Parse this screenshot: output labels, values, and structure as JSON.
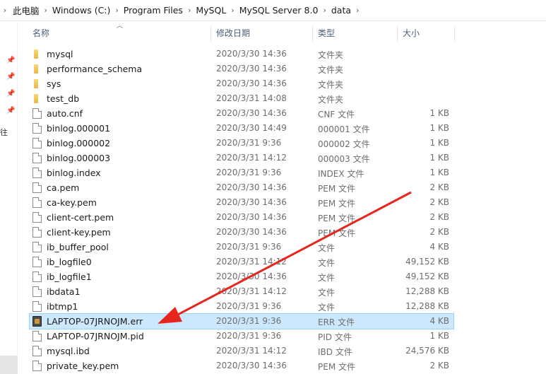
{
  "breadcrumb": [
    "此电脑",
    "Windows (C:)",
    "Program Files",
    "MySQL",
    "MySQL Server 8.0",
    "data"
  ],
  "left_rail_text": "往",
  "columns": {
    "name": "名称",
    "date": "修改日期",
    "type": "类型",
    "size": "大小"
  },
  "files": [
    {
      "name": "mysql",
      "date": "2020/3/30 14:36",
      "type": "文件夹",
      "size": "",
      "kind": "folder"
    },
    {
      "name": "performance_schema",
      "date": "2020/3/30 14:36",
      "type": "文件夹",
      "size": "",
      "kind": "folder"
    },
    {
      "name": "sys",
      "date": "2020/3/30 14:36",
      "type": "文件夹",
      "size": "",
      "kind": "folder"
    },
    {
      "name": "test_db",
      "date": "2020/3/31 14:08",
      "type": "文件夹",
      "size": "",
      "kind": "folder"
    },
    {
      "name": "auto.cnf",
      "date": "2020/3/30 14:36",
      "type": "CNF 文件",
      "size": "1 KB",
      "kind": "file"
    },
    {
      "name": "binlog.000001",
      "date": "2020/3/30 14:49",
      "type": "000001 文件",
      "size": "1 KB",
      "kind": "file"
    },
    {
      "name": "binlog.000002",
      "date": "2020/3/31 9:36",
      "type": "000002 文件",
      "size": "1 KB",
      "kind": "file"
    },
    {
      "name": "binlog.000003",
      "date": "2020/3/31 14:12",
      "type": "000003 文件",
      "size": "1 KB",
      "kind": "file"
    },
    {
      "name": "binlog.index",
      "date": "2020/3/31 9:36",
      "type": "INDEX 文件",
      "size": "1 KB",
      "kind": "file"
    },
    {
      "name": "ca.pem",
      "date": "2020/3/30 14:36",
      "type": "PEM 文件",
      "size": "2 KB",
      "kind": "file"
    },
    {
      "name": "ca-key.pem",
      "date": "2020/3/30 14:36",
      "type": "PEM 文件",
      "size": "2 KB",
      "kind": "file"
    },
    {
      "name": "client-cert.pem",
      "date": "2020/3/30 14:36",
      "type": "PEM 文件",
      "size": "2 KB",
      "kind": "file"
    },
    {
      "name": "client-key.pem",
      "date": "2020/3/30 14:36",
      "type": "PEM 文件",
      "size": "2 KB",
      "kind": "file"
    },
    {
      "name": "ib_buffer_pool",
      "date": "2020/3/31 9:36",
      "type": "文件",
      "size": "4 KB",
      "kind": "file"
    },
    {
      "name": "ib_logfile0",
      "date": "2020/3/31 14:12",
      "type": "文件",
      "size": "49,152 KB",
      "kind": "file"
    },
    {
      "name": "ib_logfile1",
      "date": "2020/3/30 14:36",
      "type": "文件",
      "size": "49,152 KB",
      "kind": "file"
    },
    {
      "name": "ibdata1",
      "date": "2020/3/31 14:12",
      "type": "文件",
      "size": "12,288 KB",
      "kind": "file"
    },
    {
      "name": "ibtmp1",
      "date": "2020/3/31 9:36",
      "type": "文件",
      "size": "12,288 KB",
      "kind": "file"
    },
    {
      "name": "LAPTOP-07JRNOJM.err",
      "date": "2020/3/31 9:36",
      "type": "ERR 文件",
      "size": "4 KB",
      "kind": "err",
      "selected": true
    },
    {
      "name": "LAPTOP-07JRNOJM.pid",
      "date": "2020/3/31 9:36",
      "type": "PID 文件",
      "size": "1 KB",
      "kind": "file"
    },
    {
      "name": "mysql.ibd",
      "date": "2020/3/31 14:12",
      "type": "IBD 文件",
      "size": "24,576 KB",
      "kind": "file"
    },
    {
      "name": "private_key.pem",
      "date": "2020/3/30 14:36",
      "type": "PEM 文件",
      "size": "2 KB",
      "kind": "file"
    }
  ],
  "colors": {
    "selection": "#cce8ff",
    "annotation_arrow": "#e8251c",
    "header_text": "#4c607a"
  },
  "icons": {
    "folder": "folder-icon",
    "file": "file-icon",
    "err": "log-file-icon",
    "pin": "pin-icon"
  }
}
